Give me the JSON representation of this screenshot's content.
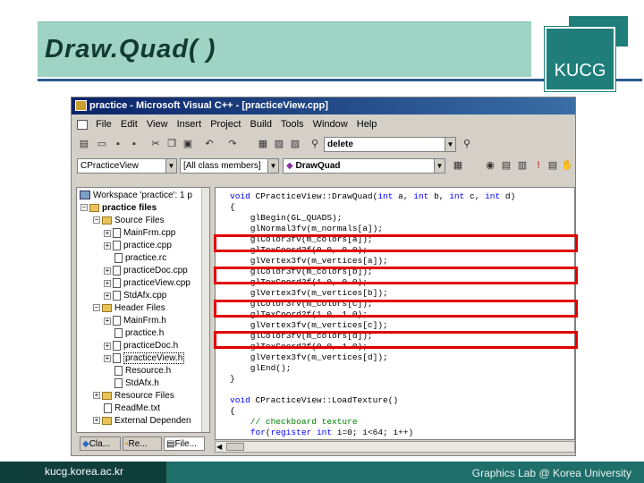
{
  "slide": {
    "title": "Draw.Quad( )",
    "logo": "KUCG",
    "footer_url": "kucg.korea.ac.kr",
    "footer_lab": "Graphics Lab @ Korea University"
  },
  "window": {
    "title": "practice - Microsoft Visual C++ - [practiceView.cpp]",
    "menu": [
      "File",
      "Edit",
      "View",
      "Insert",
      "Project",
      "Build",
      "Tools",
      "Window",
      "Help"
    ],
    "find_combo": "delete",
    "class_combo": "CPracticeView",
    "members_combo": "[All class members]",
    "function_combo": "DrawQuad"
  },
  "tree": {
    "workspace": "Workspace 'practice': 1 p",
    "project": "practice files",
    "source_folder": "Source Files",
    "source_files": [
      "MainFrm.cpp",
      "practice.cpp",
      "practice.rc",
      "practiceDoc.cpp",
      "practiceView.cpp",
      "StdAfx.cpp"
    ],
    "header_folder": "Header Files",
    "header_files": [
      "MainFrm.h",
      "practice.h",
      "practiceDoc.h",
      "practiceView.h",
      "Resource.h",
      "StdAfx.h"
    ],
    "resource_folder": "Resource Files",
    "readme": "ReadMe.txt",
    "external": "External Dependen",
    "tabs": [
      "Cla...",
      "Re...",
      "File..."
    ]
  },
  "code": [
    "void CPracticeView::DrawQuad(int a, int b, int c, int d)",
    "{",
    "    glBegin(GL_QUADS);",
    "    glNormal3fv(m_normals[a]);",
    "    glColor3fv(m_colors[a]);",
    "    glTexCoord2f(0.0, 0.0);",
    "    glVertex3fv(m_vertices[a]);",
    "    glColor3fv(m_colors[b]);",
    "    glTexCoord2f(1.0, 0.0);",
    "    glVertex3fv(m_vertices[b]);",
    "    glColor3fv(m_colors[c]);",
    "    glTexCoord2f(1.0, 1.0);",
    "    glVertex3fv(m_vertices[c]);",
    "    glColor3fv(m_colors[d]);",
    "    glTexCoord2f(0.0, 1.0);",
    "    glVertex3fv(m_vertices[d]);",
    "    glEnd();",
    "}",
    "",
    "void CPracticeView::LoadTexture()",
    "{",
    "    // checkboard texture",
    "    for(register int i=0; i<64; i++)",
    "    {"
  ],
  "highlight_color": "#e00000"
}
